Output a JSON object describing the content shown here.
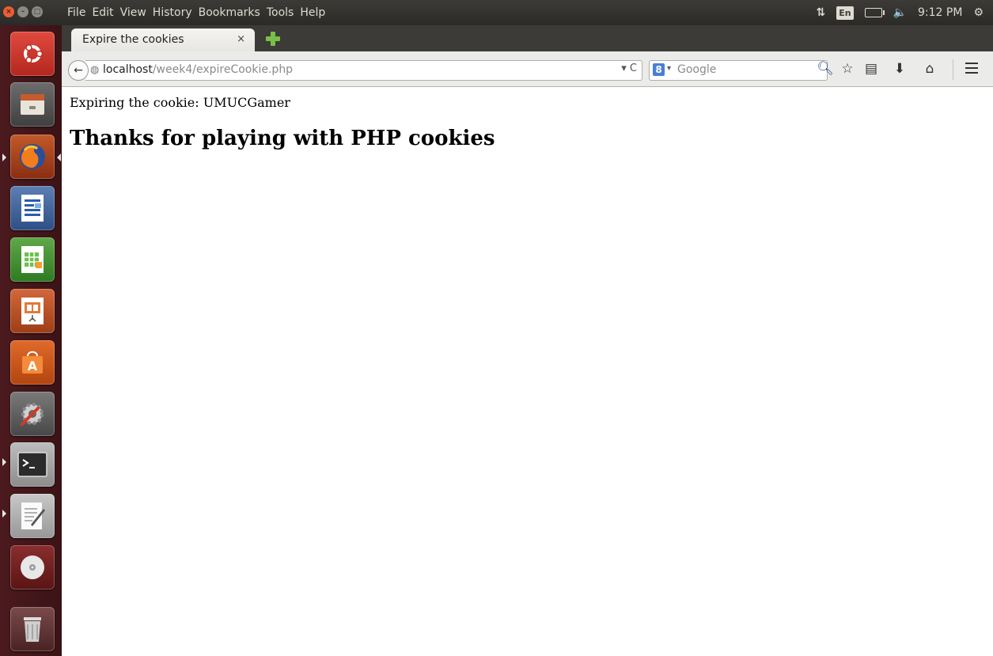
{
  "system_panel": {
    "menus": [
      "File",
      "Edit",
      "View",
      "History",
      "Bookmarks",
      "Tools",
      "Help"
    ],
    "keyboard_layout": "En",
    "clock": "9:12 PM"
  },
  "browser": {
    "tab": {
      "title": "Expire the cookies",
      "close_glyph": "×"
    },
    "url": {
      "host": "localhost",
      "path": "/week4/expireCookie.php"
    },
    "search": {
      "placeholder": "Google",
      "engine_badge": "8"
    }
  },
  "page": {
    "expire_line": "Expiring the cookie: UMUCGamer",
    "heading": "Thanks for playing with PHP cookies"
  },
  "launcher": {
    "items": [
      "ubuntu-dash-icon",
      "files-icon",
      "firefox-icon",
      "writer-icon",
      "calc-icon",
      "impress-icon",
      "software-center-icon",
      "system-settings-icon",
      "terminal-icon",
      "text-editor-icon",
      "dvd-icon",
      "trash-icon"
    ]
  },
  "colors": {
    "panel": "#3c3b37",
    "launcher": "#4b1a1e",
    "accent_orange": "#e95f36"
  }
}
